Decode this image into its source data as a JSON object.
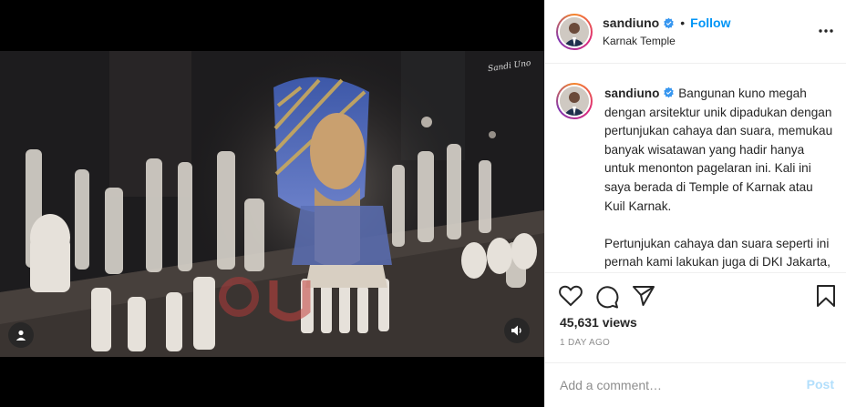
{
  "post": {
    "username": "sandiuno",
    "follow_label": "Follow",
    "dot": "•",
    "location": "Karnak Temple",
    "caption": " Bangunan kuno megah dengan arsitektur unik dipadukan dengan pertunjukan cahaya dan suara, memukau banyak wisatawan yang hadir hanya untuk menonton pagelaran ini. Kali ini saya berada di Temple of Karnak atau Kuil Karnak.\n\nPertunjukan cahaya dan suara seperti ini pernah kami lakukan juga di DKI Jakarta, tepatnya di Monumen",
    "views": "45,631 views",
    "time_ago": "1 DAY AGO"
  },
  "media": {
    "watermark": "Sandi Uno"
  },
  "comment": {
    "placeholder": "Add a comment…",
    "post_label": "Post"
  },
  "icons": {
    "more": "more-options-icon",
    "verified": "verified-badge-icon",
    "like": "heart-icon",
    "comment": "comment-icon",
    "share": "paper-plane-icon",
    "save": "bookmark-icon",
    "user_tag": "user-tag-icon",
    "sound": "speaker-icon"
  },
  "colors": {
    "accent": "#0095f6",
    "post_disabled": "#b2dffc",
    "muted": "#8e8e8e",
    "border": "#efefef"
  }
}
